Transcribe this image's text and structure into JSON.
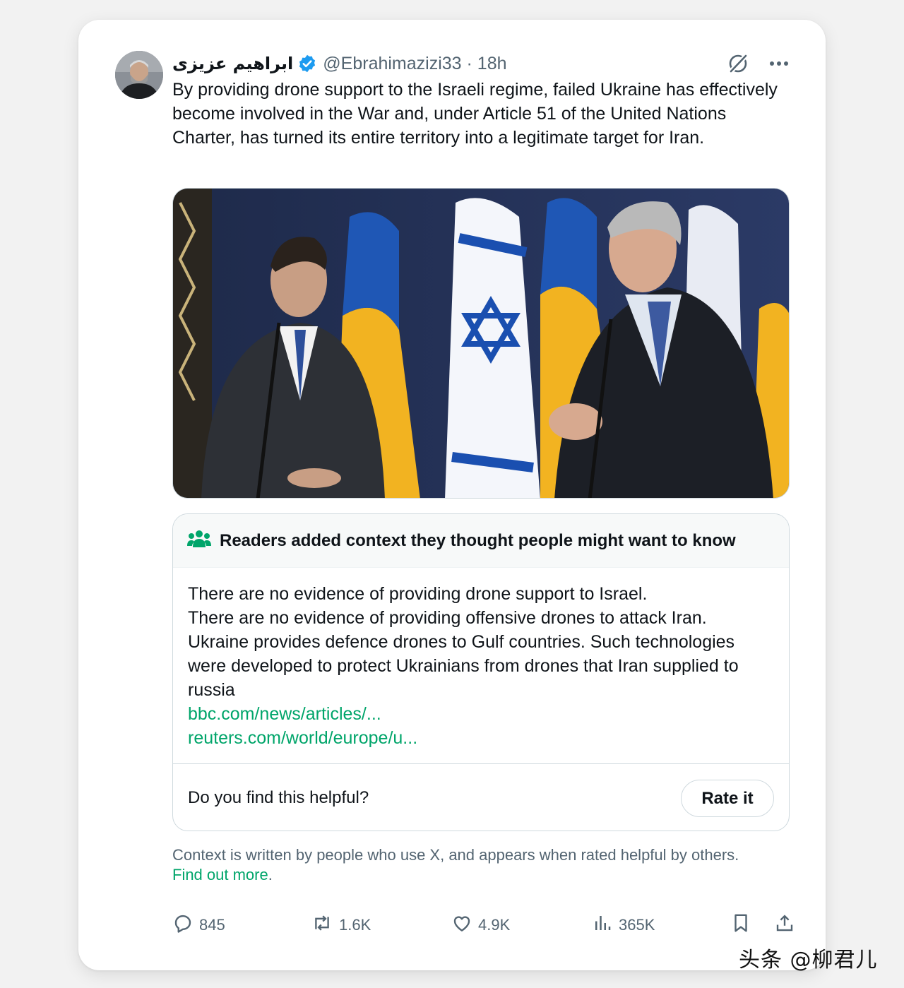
{
  "tweet": {
    "display_name": "ابراهیم عزیزی",
    "handle_time": "@Ebrahimazizi33 · 18h",
    "text": "By providing drone support to the Israeli regime, failed Ukraine has effectively become involved in the War and, under Article 51 of the United Nations Charter, has turned its entire territory into a legitimate target for Iran."
  },
  "note": {
    "header": "Readers added context they thought people might want to know",
    "lines": [
      "There are no evidence of providing drone support to Israel.",
      "There are no evidence of providing offensive drones to attack Iran.",
      "Ukraine provides defence drones to Gulf countries. Such technologies were developed to protect Ukrainians from drones that Iran supplied to russia"
    ],
    "links": [
      "bbc.com/news/articles/...",
      "reuters.com/world/europe/u..."
    ],
    "helpful_question": "Do you find this helpful?",
    "rate_label": "Rate it"
  },
  "disclaimer": {
    "text": "Context is written by people who use X, and appears when rated helpful by others.",
    "link": "Find out more",
    "end": "."
  },
  "actions": {
    "replies": "845",
    "reposts": "1.6K",
    "likes": "4.9K",
    "views": "365K"
  },
  "watermark": "头条 @柳君儿",
  "colors": {
    "accent_green": "#00a56a",
    "verified_blue": "#1d9bf0",
    "muted_text": "#536471"
  }
}
